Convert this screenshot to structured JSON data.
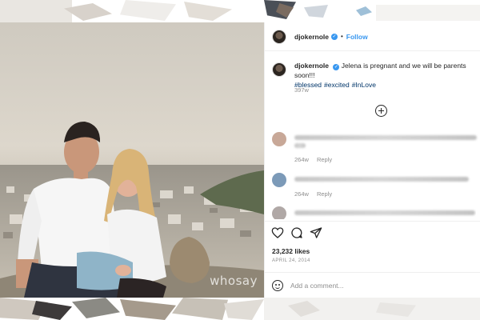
{
  "post": {
    "username": "djokernole",
    "follow_label": "Follow",
    "dot": "•",
    "verified_symbol": "✓",
    "caption_text": "Jelena is pregnant and we will be parents soon!!!",
    "hashtags": [
      "#blessed",
      "#excited",
      "#InLove"
    ],
    "time_ago": "397w",
    "watermark": "whosay"
  },
  "comments": [
    {
      "time": "264w",
      "reply_label": "Reply",
      "avatar_color": "#c8a898"
    },
    {
      "time": "264w",
      "reply_label": "Reply",
      "avatar_color": "#7c9ab8"
    },
    {
      "time": "",
      "reply_label": "",
      "avatar_color": "#b0a8a6"
    }
  ],
  "actions": {
    "likes_text": "23,232 likes",
    "date_text": "APRIL 24, 2014",
    "icons": [
      "heart-icon",
      "comment-icon",
      "share-icon"
    ]
  },
  "add_comment": {
    "placeholder": "Add a comment..."
  },
  "colors": {
    "link_blue": "#3897f0",
    "hashtag": "#003569",
    "muted": "#8e8e8e",
    "text": "#262626"
  }
}
